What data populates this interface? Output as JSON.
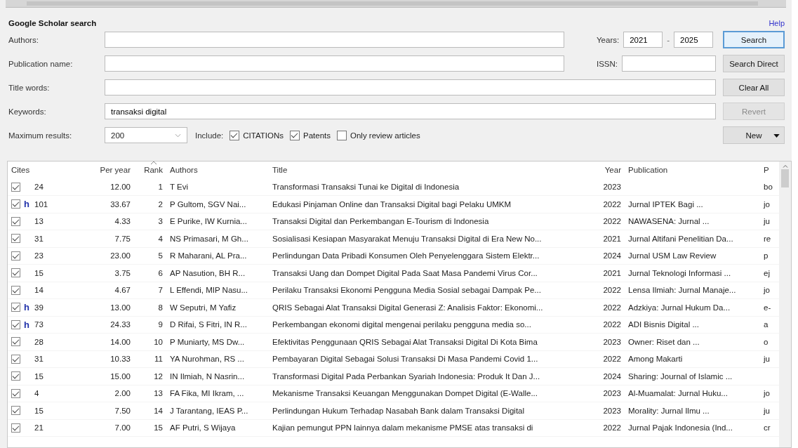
{
  "panel": {
    "title": "Google Scholar search",
    "help": "Help"
  },
  "form": {
    "authors": {
      "label": "Authors:"
    },
    "years": {
      "label": "Years:",
      "from": "2021",
      "separator": "-",
      "to": "2025"
    },
    "publication": {
      "label": "Publication name:"
    },
    "issn": {
      "label": "ISSN:"
    },
    "title_words": {
      "label": "Title words:"
    },
    "keywords": {
      "label": "Keywords:",
      "value": "transaksi digital"
    },
    "max_results": {
      "label": "Maximum results:",
      "value": "200"
    },
    "include_label": "Include:",
    "options": [
      {
        "label": "CITATIONs",
        "checked": true
      },
      {
        "label": "Patents",
        "checked": true
      },
      {
        "label": "Only review articles",
        "checked": false
      }
    ]
  },
  "buttons": [
    {
      "label": "Search",
      "default": true,
      "disabled": false,
      "dropdown": false
    },
    {
      "label": "Search Direct",
      "default": false,
      "disabled": false,
      "dropdown": false
    },
    {
      "label": "Clear All",
      "default": false,
      "disabled": false,
      "dropdown": false
    },
    {
      "label": "Revert",
      "default": false,
      "disabled": true,
      "dropdown": false
    },
    {
      "label": "New",
      "default": false,
      "disabled": false,
      "dropdown": true
    }
  ],
  "table": {
    "columns": [
      {
        "label": "Cites",
        "sorted": false
      },
      {
        "label": "Per year",
        "sorted": false
      },
      {
        "label": "Rank",
        "sorted": true
      },
      {
        "label": "Authors",
        "sorted": false
      },
      {
        "label": "Title",
        "sorted": false
      },
      {
        "label": "Year",
        "sorted": false
      },
      {
        "label": "Publication",
        "sorted": false
      },
      {
        "label": "P",
        "sorted": false
      }
    ],
    "rows": [
      {
        "checked": true,
        "cites": "24",
        "per_year": "12.00",
        "rank": "1",
        "authors": "T Evi",
        "title": "Transformasi Transaksi Tunai ke Digital di Indonesia",
        "year": "2023",
        "column_8": "bo"
      },
      {
        "checked": true,
        "flag": "h",
        "cites": "101",
        "per_year": "33.67",
        "rank": "2",
        "authors": "P Gultom, SGV Nai...",
        "title": "Edukasi Pinjaman Online dan Transaksi Digital bagi Pelaku UMKM",
        "year": "2022",
        "publication": "Jurnal IPTEK Bagi ...",
        "column_8": "jo"
      },
      {
        "checked": true,
        "cites": "13",
        "per_year": "4.33",
        "rank": "3",
        "authors": "E Purike, IW Kurnia...",
        "title": "Transaksi Digital dan Perkembangan E-Tourism di Indonesia",
        "year": "2022",
        "publication": "NAWASENA: Jurnal ...",
        "column_8": "ju"
      },
      {
        "checked": true,
        "cites": "31",
        "per_year": "7.75",
        "rank": "4",
        "authors": "NS Primasari, M Gh...",
        "title": "Sosialisasi Kesiapan Masyarakat Menuju Transaksi Digital di Era New No...",
        "year": "2021",
        "publication": "Jurnal Altifani Penelitian Da...",
        "column_8": "re"
      },
      {
        "checked": true,
        "cites": "23",
        "per_year": "23.00",
        "rank": "5",
        "authors": "R Maharani, AL Pra...",
        "title": "Perlindungan Data Pribadi Konsumen Oleh Penyelenggara Sistem Elektr...",
        "year": "2024",
        "publication": "Jurnal USM Law Review",
        "column_8": "p"
      },
      {
        "checked": true,
        "cites": "15",
        "per_year": "3.75",
        "rank": "6",
        "authors": "AP Nasution, BH R...",
        "title": "Transaksi Uang dan Dompet Digital Pada Saat Masa Pandemi Virus Cor...",
        "year": "2021",
        "publication": "Jurnal Teknologi Informasi ...",
        "column_8": "ej"
      },
      {
        "checked": true,
        "cites": "14",
        "per_year": "4.67",
        "rank": "7",
        "authors": "L Effendi, MIP Nasu...",
        "title": "Perilaku Transaksi Ekonomi Pengguna Media Sosial sebagai Dampak Pe...",
        "year": "2022",
        "publication": "Lensa Ilmiah: Jurnal Manaje...",
        "column_8": "jo"
      },
      {
        "checked": true,
        "flag": "h",
        "cites": "39",
        "per_year": "13.00",
        "rank": "8",
        "authors": "W Seputri, M Yafiz",
        "title": "QRIS Sebagai Alat Transaksi Digital Generasi Z: Analisis Faktor: Ekonomi...",
        "year": "2022",
        "publication": "Adzkiya: Jurnal Hukum Da...",
        "column_8": "e-"
      },
      {
        "checked": true,
        "flag": "h",
        "cites": "73",
        "per_year": "24.33",
        "rank": "9",
        "authors": "D Rifai, S Fitri, IN R...",
        "title": "Perkembangan ekonomi digital mengenai perilaku pengguna media so...",
        "year": "2022",
        "publication": "ADI Bisnis Digital ...",
        "column_8": "a"
      },
      {
        "checked": true,
        "cites": "28",
        "per_year": "14.00",
        "rank": "10",
        "authors": "P Muniarty, MS Dw...",
        "title": "Efektivitas Penggunaan QRIS Sebagai Alat Transaksi Digital Di Kota Bima",
        "year": "2023",
        "publication": "Owner: Riset dan ...",
        "column_8": "o"
      },
      {
        "checked": true,
        "cites": "31",
        "per_year": "10.33",
        "rank": "11",
        "authors": "YA Nurohman, RS ...",
        "title": "Pembayaran Digital Sebagai Solusi Transaksi Di Masa Pandemi Covid 1...",
        "year": "2022",
        "publication": "Among Makarti",
        "column_8": "ju"
      },
      {
        "checked": true,
        "cites": "15",
        "per_year": "15.00",
        "rank": "12",
        "authors": "IN Ilmiah, N Nasrin...",
        "title": "Transformasi Digital Pada Perbankan Syariah Indonesia: Produk It Dan J...",
        "year": "2024",
        "publication": "Sharing: Journal of Islamic ..."
      },
      {
        "checked": true,
        "cites": "4",
        "per_year": "2.00",
        "rank": "13",
        "authors": "FA Fika, MI Ikram, ...",
        "title": "Mekanisme Transaksi Keuangan Menggunakan Dompet Digital (E-Walle...",
        "year": "2023",
        "publication": "Al-Muamalat: Jurnal Huku...",
        "column_8": "jo"
      },
      {
        "checked": true,
        "cites": "15",
        "per_year": "7.50",
        "rank": "14",
        "authors": "J Tarantang, IEAS P...",
        "title": "Perlindungan Hukum Terhadap Nasabah Bank dalam Transaksi Digital",
        "year": "2023",
        "publication": "Morality: Jurnal Ilmu ...",
        "column_8": "ju"
      },
      {
        "checked": true,
        "cites": "21",
        "per_year": "7.00",
        "rank": "15",
        "authors": "AF Putri, S Wijaya",
        "title": "Kajian pemungut PPN lainnya dalam mekanisme PMSE atas transaksi di",
        "year": "2022",
        "publication": "Jurnal Pajak Indonesia (Ind...",
        "column_8": "cr"
      }
    ]
  }
}
